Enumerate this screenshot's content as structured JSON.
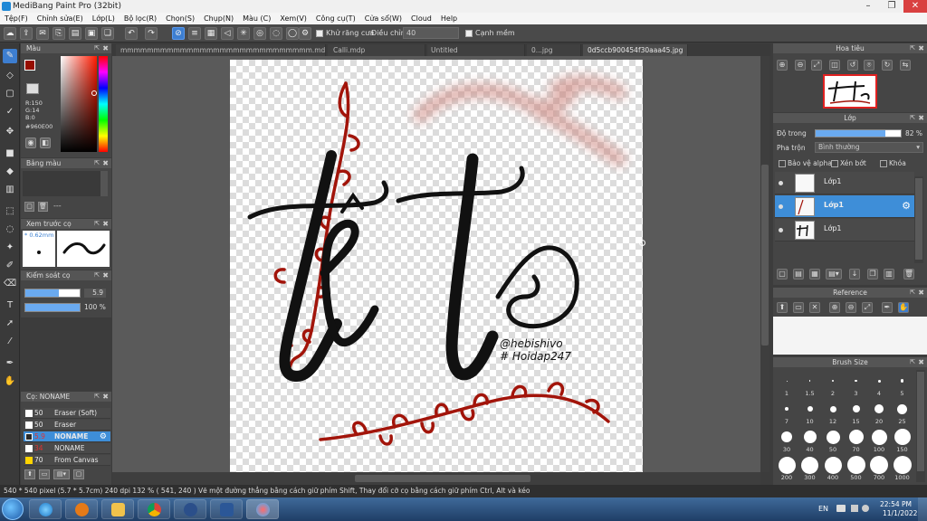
{
  "window": {
    "title": "MediBang Paint Pro (32bit)",
    "controls": [
      "–",
      "❐",
      "✕"
    ]
  },
  "menu": [
    "Tệp(F)",
    "Chỉnh sửa(E)",
    "Lớp(L)",
    "Bộ lọc(R)",
    "Chọn(S)",
    "Chụp(N)",
    "Màu (C)",
    "Xem(V)",
    "Công cụ(T)",
    "Cửa sổ(W)",
    "Cloud",
    "Help"
  ],
  "toolbar": {
    "antialias_label": "Khử răng cưa",
    "correction_label": "Điều chỉnh",
    "correction_value": "40",
    "soft_edge_label": "Cạnh mềm"
  },
  "tabs": [
    "mmmmmmmmmmmmmmmmmmmmmmmmmmmmm.mdp",
    "Calli.mdp",
    "Untitled",
    "0...jpg",
    "0d5ccb900454f30aaa45.jpg"
  ],
  "color_panel": {
    "title": "Màu",
    "r": "R:150",
    "g": "G:14",
    "b": "B:0",
    "hex": "#960E00",
    "primary_color": "#960E00"
  },
  "palette_panel": {
    "title": "Bảng màu",
    "placeholder": "---"
  },
  "brush_preview_panel": {
    "title": "Xem trước cọ",
    "size": "* 0.62mm"
  },
  "brush_control_panel": {
    "title": "Kiểm soát cọ",
    "size_value": "5.9",
    "opacity_value": "100 %",
    "size_fill": 0.62,
    "opacity_fill": 1.0
  },
  "brush_list_panel": {
    "title": "Cọ: NONAME",
    "items": [
      {
        "size": "50",
        "name": "Eraser (Soft)",
        "color": "#ffffff"
      },
      {
        "size": "50",
        "name": "Eraser",
        "color": "#ffffff"
      },
      {
        "size": "5.9",
        "name": "NONAME",
        "color": "#2a2a2a"
      },
      {
        "size": "34",
        "name": "NONAME",
        "color": "#ffffff"
      },
      {
        "size": "70",
        "name": "From Canvas",
        "color": "#ffd400"
      }
    ]
  },
  "navigator_panel": {
    "title": "Hoa tiêu"
  },
  "layer_panel": {
    "title": "Lớp",
    "opacity_label": "Độ trong",
    "opacity_value": "82 %",
    "opacity_fill": 0.82,
    "blend_label": "Pha trộn",
    "blend_value": "Bình thường",
    "protect_alpha": "Bảo vệ alpha",
    "clipping": "Xén bớt",
    "lock": "Khóa",
    "layers": [
      {
        "name": "Lớp1"
      },
      {
        "name": "Lớp1"
      },
      {
        "name": "Lớp1"
      }
    ]
  },
  "reference_panel": {
    "title": "Reference"
  },
  "brush_size_panel": {
    "title": "Brush Size",
    "sizes": [
      "1",
      "1.5",
      "2",
      "3",
      "4",
      "5",
      "7",
      "10",
      "12",
      "15",
      "20",
      "25",
      "30",
      "40",
      "50",
      "70",
      "100",
      "150",
      "200",
      "300",
      "400",
      "500",
      "700",
      "1000"
    ]
  },
  "canvas": {
    "text_main": "têt",
    "signature_line1": "@hebishivo",
    "signature_line2": "# Hoidap247"
  },
  "status": {
    "text": "540 * 540 pixel   (5.7 * 5.7cm)   240 dpi   132 %   ( 541, 240 )   Vẽ một đường thẳng bằng cách giữ phím Shift, Thay đổi cỡ cọ bằng cách giữ phím Ctrl, Alt và kéo"
  },
  "taskbar": {
    "language": "EN",
    "time": "22:54 PM",
    "date": "11/1/2022"
  }
}
